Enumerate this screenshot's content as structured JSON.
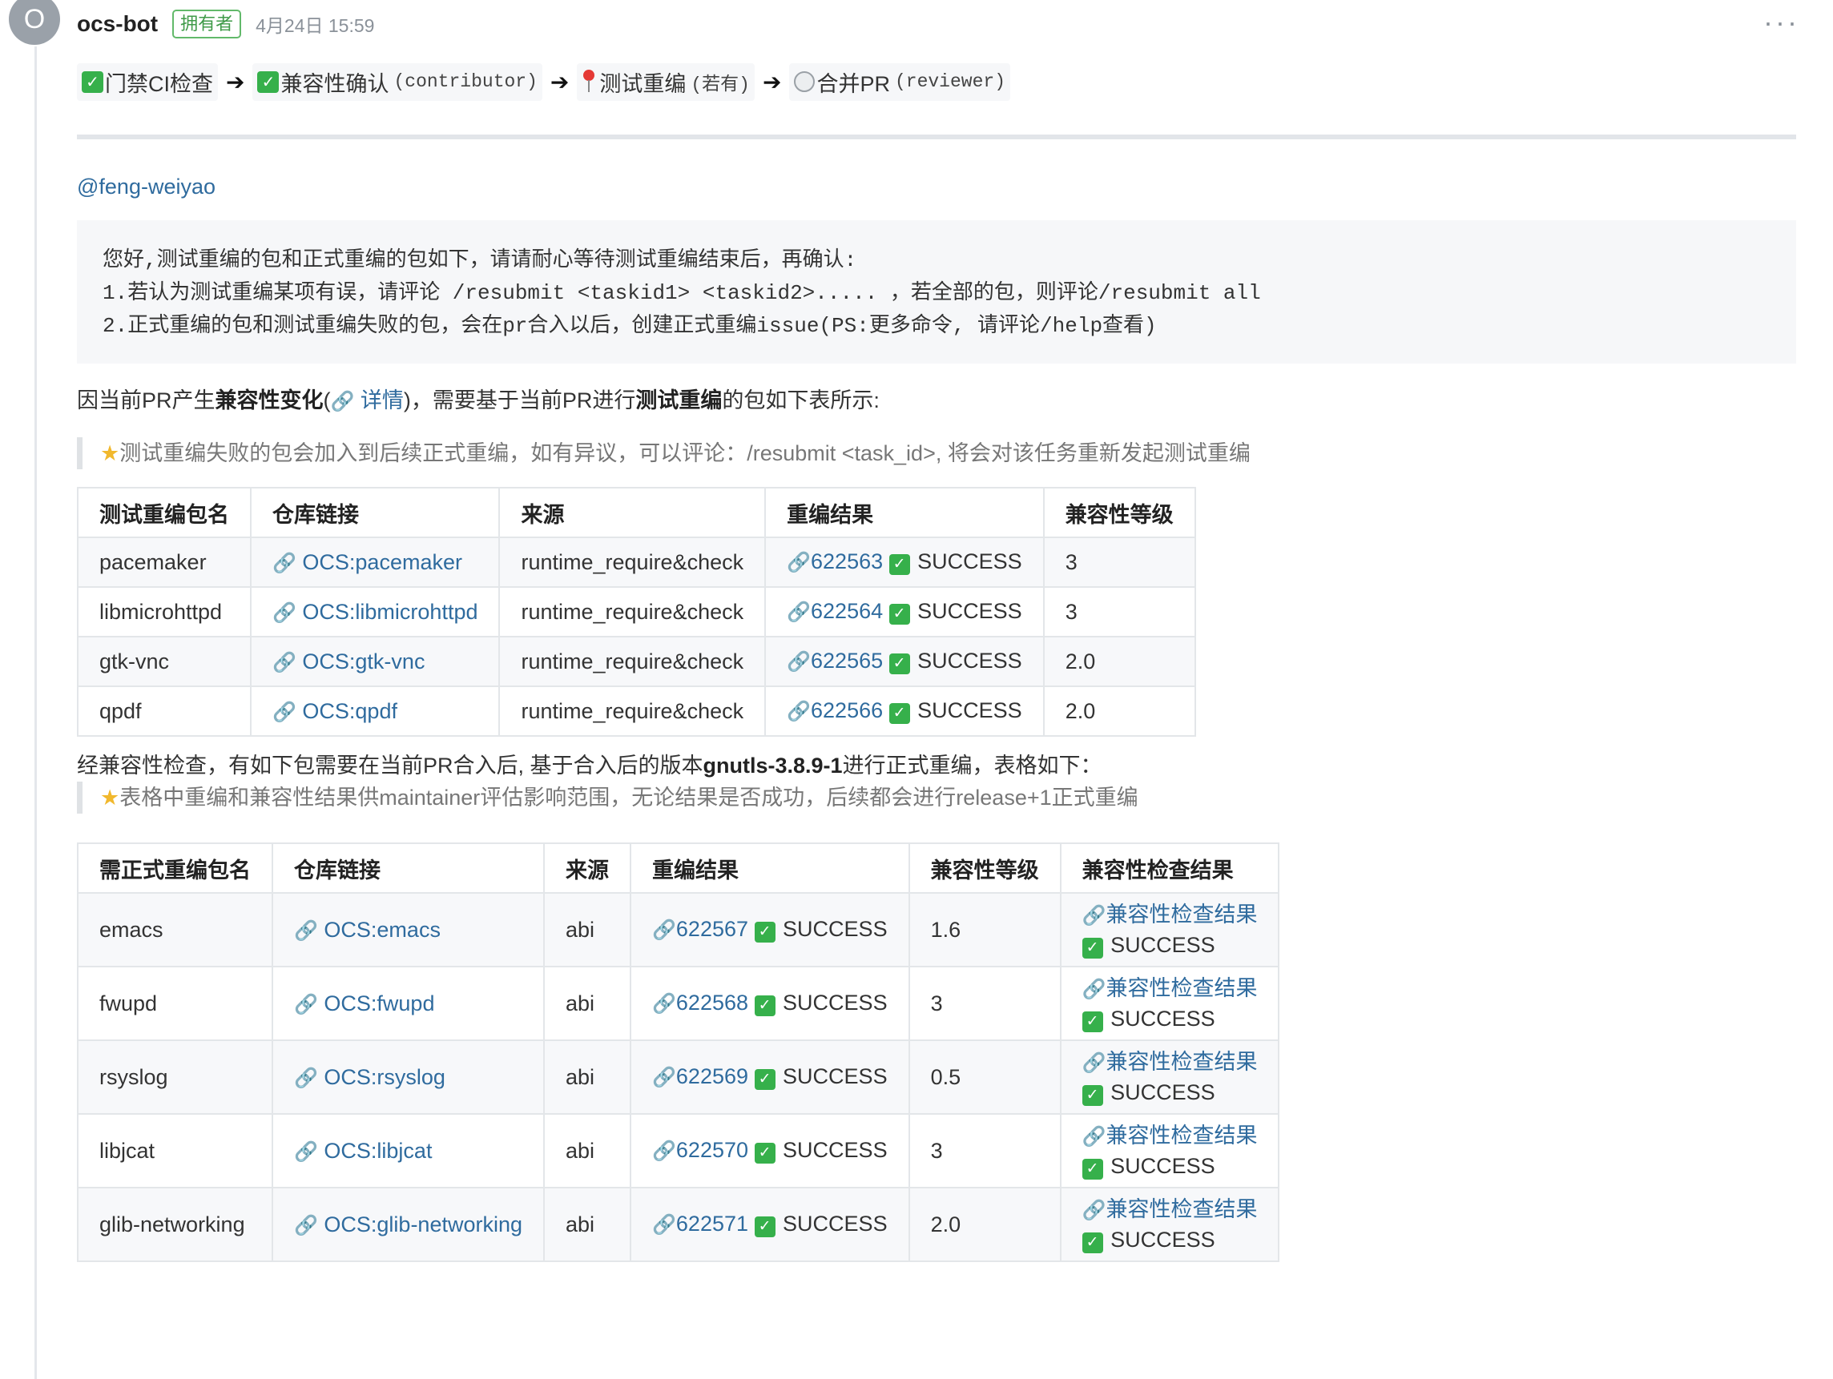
{
  "comment": {
    "avatar_letter": "O",
    "author": "ocs-bot",
    "badge": "拥有者",
    "time": "4月24日 15:59",
    "more": "···"
  },
  "pipeline": {
    "step1": "门禁CI检查",
    "step2": "兼容性确认",
    "step2_role": "(contributor)",
    "step3": "测试重编",
    "step3_note": "(若有)",
    "step4": "合并PR",
    "step4_role": "(reviewer)",
    "arrow": "➔"
  },
  "mention": "@feng-weiyao",
  "code_lines": [
    "您好,测试重编的包和正式重编的包如下，请请耐心等待测试重编结束后，再确认:",
    "1.若认为测试重编某项有误，请评论 /resubmit <taskid1> <taskid2>..... ，若全部的包，则评论/resubmit all",
    "2.正式重编的包和测试重编失败的包，会在pr合入以后，创建正式重编issue(PS:更多命令, 请评论/help查看)"
  ],
  "intro": {
    "p1": "因当前PR产生",
    "b1": "兼容性变化",
    "p2": "(",
    "link": "详情",
    "p3": ")，需要基于当前PR进行",
    "b2": "测试重编",
    "p4": "的包如下表所示:"
  },
  "quote1": "测试重编失败的包会加入到后续正式重编，如有异议，可以评论：/resubmit <task_id>, 将会对该任务重新发起测试重编",
  "table1": {
    "headers": [
      "测试重编包名",
      "仓库链接",
      "来源",
      "重编结果",
      "兼容性等级"
    ],
    "rows": [
      {
        "name": "pacemaker",
        "repo": "OCS:pacemaker",
        "source": "runtime_require&check",
        "task": "622563",
        "result": "SUCCESS",
        "level": "3"
      },
      {
        "name": "libmicrohttpd",
        "repo": "OCS:libmicrohttpd",
        "source": "runtime_require&check",
        "task": "622564",
        "result": "SUCCESS",
        "level": "3"
      },
      {
        "name": "gtk-vnc",
        "repo": "OCS:gtk-vnc",
        "source": "runtime_require&check",
        "task": "622565",
        "result": "SUCCESS",
        "level": "2.0"
      },
      {
        "name": "qpdf",
        "repo": "OCS:qpdf",
        "source": "runtime_require&check",
        "task": "622566",
        "result": "SUCCESS",
        "level": "2.0"
      }
    ]
  },
  "para2": {
    "p1": "经兼容性检查，有如下包需要在当前PR合入后, 基于合入后的版本",
    "b1": "gnutls-3.8.9-1",
    "p2": "进行正式重编，表格如下："
  },
  "quote2": "表格中重编和兼容性结果供maintainer评估影响范围，无论结果是否成功，后续都会进行release+1正式重编",
  "table2": {
    "headers": [
      "需正式重编包名",
      "仓库链接",
      "来源",
      "重编结果",
      "兼容性等级",
      "兼容性检查结果"
    ],
    "rows": [
      {
        "name": "emacs",
        "repo": "OCS:emacs",
        "source": "abi",
        "task": "622567",
        "result": "SUCCESS",
        "level": "1.6",
        "check_link": "兼容性检查结果",
        "check_result": "SUCCESS"
      },
      {
        "name": "fwupd",
        "repo": "OCS:fwupd",
        "source": "abi",
        "task": "622568",
        "result": "SUCCESS",
        "level": "3",
        "check_link": "兼容性检查结果",
        "check_result": "SUCCESS"
      },
      {
        "name": "rsyslog",
        "repo": "OCS:rsyslog",
        "source": "abi",
        "task": "622569",
        "result": "SUCCESS",
        "level": "0.5",
        "check_link": "兼容性检查结果",
        "check_result": "SUCCESS"
      },
      {
        "name": "libjcat",
        "repo": "OCS:libjcat",
        "source": "abi",
        "task": "622570",
        "result": "SUCCESS",
        "level": "3",
        "check_link": "兼容性检查结果",
        "check_result": "SUCCESS"
      },
      {
        "name": "glib-networking",
        "repo": "OCS:glib-networking",
        "source": "abi",
        "task": "622571",
        "result": "SUCCESS",
        "level": "2.0",
        "check_link": "兼容性检查结果",
        "check_result": "SUCCESS"
      }
    ]
  },
  "glyphs": {
    "check": "✓",
    "chain": "🔗",
    "star": "★"
  },
  "colors": {
    "link": "#2f6b9e",
    "success": "#36b04b",
    "owner_badge": "#62b96a"
  }
}
